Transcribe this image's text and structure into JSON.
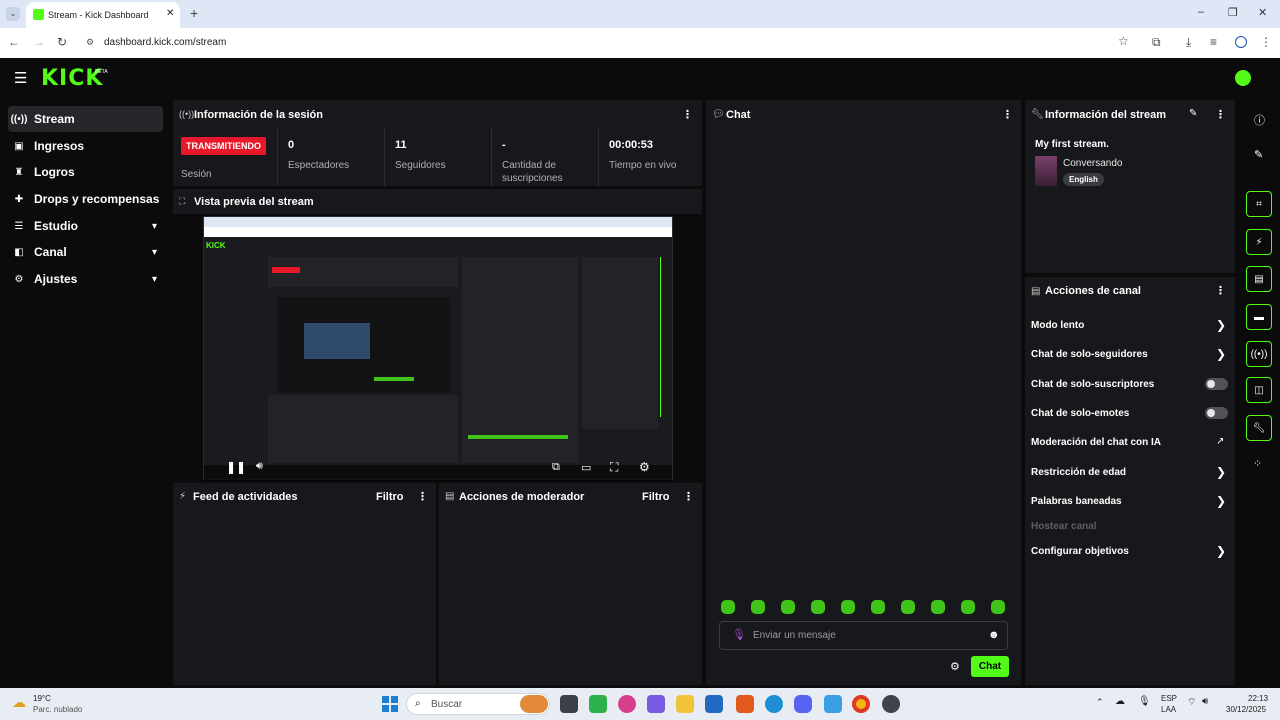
{
  "browser": {
    "tab_title": "Stream - Kick Dashboard",
    "new_tab": "+",
    "url": "dashboard.kick.com/stream",
    "window_controls": [
      "–",
      "❐",
      "✕"
    ]
  },
  "app": {
    "logo": "KICK",
    "logo_badge": "BETA"
  },
  "sidebar": {
    "items": [
      {
        "label": "Stream",
        "icon": "broadcast-icon",
        "active": true
      },
      {
        "label": "Ingresos",
        "icon": "cash-icon"
      },
      {
        "label": "Logros",
        "icon": "trophy-icon"
      },
      {
        "label": "Drops y recompensas",
        "icon": "gift-icon"
      },
      {
        "label": "Estudio",
        "icon": "sliders-icon",
        "expandable": true
      },
      {
        "label": "Canal",
        "icon": "channel-icon",
        "expandable": true
      },
      {
        "label": "Ajustes",
        "icon": "gear-icon",
        "expandable": true
      }
    ]
  },
  "session": {
    "title": "Información de la sesión",
    "status_badge": "TRANSMITIENDO",
    "status_label": "Sesión",
    "stats": [
      {
        "value": "0",
        "label": "Espectadores"
      },
      {
        "value": "11",
        "label": "Seguidores"
      },
      {
        "value": "-",
        "label": "Cantidad de suscripciones"
      },
      {
        "value": "00:00:53",
        "label": "Tiempo en vivo"
      }
    ]
  },
  "preview": {
    "title": "Vista previa del stream"
  },
  "activity": {
    "title": "Feed de actividades",
    "filter": "Filtro"
  },
  "moderator": {
    "title": "Acciones de moderador",
    "filter": "Filtro"
  },
  "chat": {
    "title": "Chat",
    "input_placeholder": "Enviar un mensaje",
    "send_label": "Chat",
    "emote_count": 10
  },
  "stream_info": {
    "title": "Información del stream",
    "stream_title": "My first stream.",
    "category": "Conversando",
    "language_tag": "English"
  },
  "channel_actions": {
    "title": "Acciones de canal",
    "items": [
      {
        "label": "Modo lento",
        "control": "chevron"
      },
      {
        "label": "Chat de solo-seguidores",
        "control": "chevron"
      },
      {
        "label": "Chat de solo-suscriptores",
        "control": "toggle",
        "on": false
      },
      {
        "label": "Chat de solo-emotes",
        "control": "toggle",
        "on": false
      },
      {
        "label": "Moderación del chat con IA",
        "control": "external"
      },
      {
        "label": "Restricción de edad",
        "control": "chevron"
      },
      {
        "label": "Palabras baneadas",
        "control": "chevron"
      },
      {
        "label": "Hostear canal",
        "control": "none",
        "disabled": true
      },
      {
        "label": "Configurar objetivos",
        "control": "chevron"
      }
    ]
  },
  "taskbar": {
    "weather_temp": "19°C",
    "weather_desc": "Parc. nublado",
    "search_placeholder": "Buscar",
    "lang_primary": "ESP",
    "lang_secondary": "LAA",
    "time": "22:13",
    "date": "30/12/2025"
  },
  "colors": {
    "brand_green": "#53fc18",
    "live_red": "#e8182b",
    "panel": "#17181b"
  }
}
